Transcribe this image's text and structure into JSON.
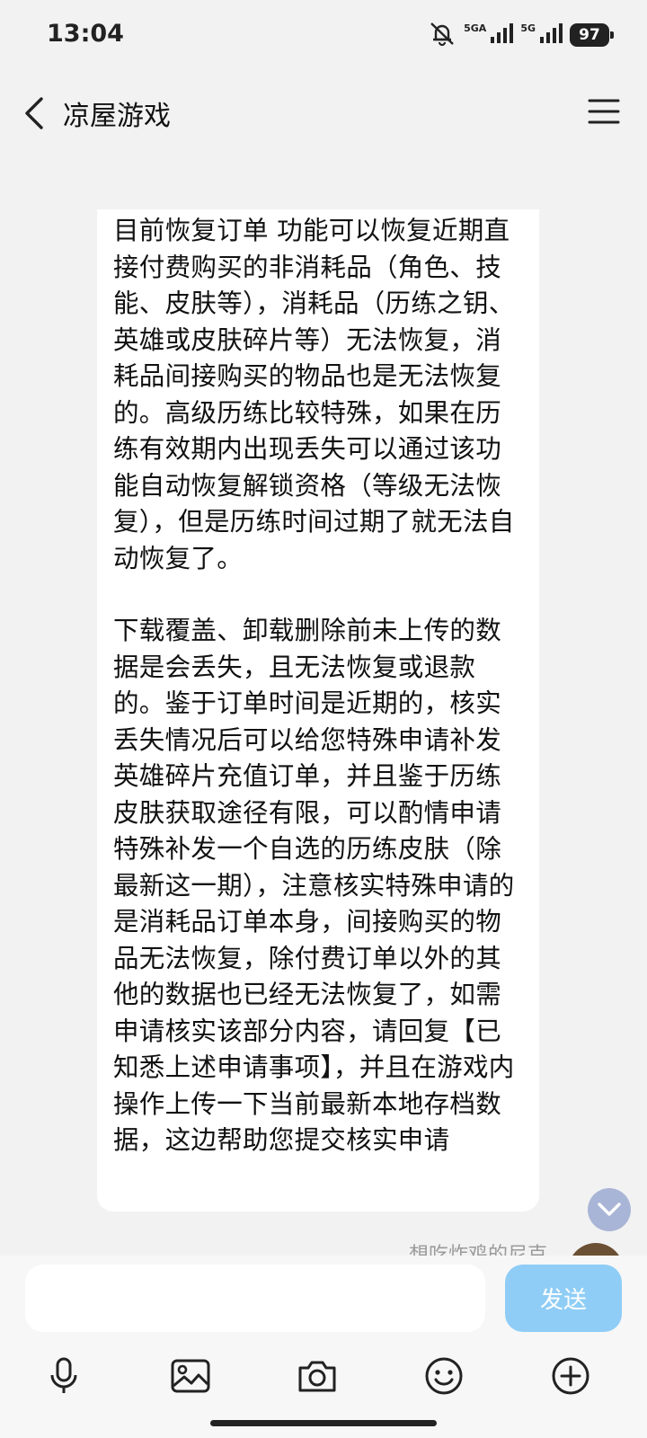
{
  "status_bar": {
    "time": "13:04",
    "signal_1_label": "5GA",
    "signal_2_label": "5G",
    "battery": "97",
    "icons": [
      "mute-bell-icon",
      "signal-icon",
      "signal-icon",
      "battery-icon"
    ]
  },
  "header": {
    "title": "凉屋游戏",
    "back_icon": "chevron-left-icon",
    "menu_icon": "hamburger-menu-icon"
  },
  "message": {
    "paragraphs": [
      "目前恢复订单 功能可以恢复近期直接付费购买的非消耗品（角色、技能、皮肤等），消耗品（历练之钥、英雄或皮肤碎片等）无法恢复，消耗品间接购买的物品也是无法恢复的。高级历练比较特殊，如果在历练有效期内出现丢失可以通过该功能自动恢复解锁资格（等级无法恢复），但是历练时间过期了就无法自动恢复了。",
      "下载覆盖、卸载删除前未上传的数据是会丢失，且无法恢复或退款的。鉴于订单时间是近期的，核实丢失情况后可以给您特殊申请补发英雄碎片充值订单，并且鉴于历练皮肤获取途径有限，可以酌情申请特殊补发一个自选的历练皮肤（除最新这一期），注意核实特殊申请的是消耗品订单本身，间接购买的物品无法恢复，除付费订单以外的其他的数据也已经无法恢复了，如需申请核实该部分内容，请回复【已知悉上述申请事项】，并且在游戏内操作上传一下当前最新本地存档数据，这边帮助您提交核实申请"
    ]
  },
  "next_message_preview": {
    "sender_name": "想吃炸鸡的尼克"
  },
  "input": {
    "value": "",
    "placeholder": "",
    "send_label": "发送"
  },
  "toolbar": {
    "icons": [
      "microphone-icon",
      "image-icon",
      "camera-icon",
      "emoji-icon",
      "plus-icon"
    ]
  },
  "colors": {
    "background": "#f2f2f2",
    "bubble": "#ffffff",
    "send_button": "#8fcdf6",
    "scroll_button": "#a9b5d6"
  }
}
